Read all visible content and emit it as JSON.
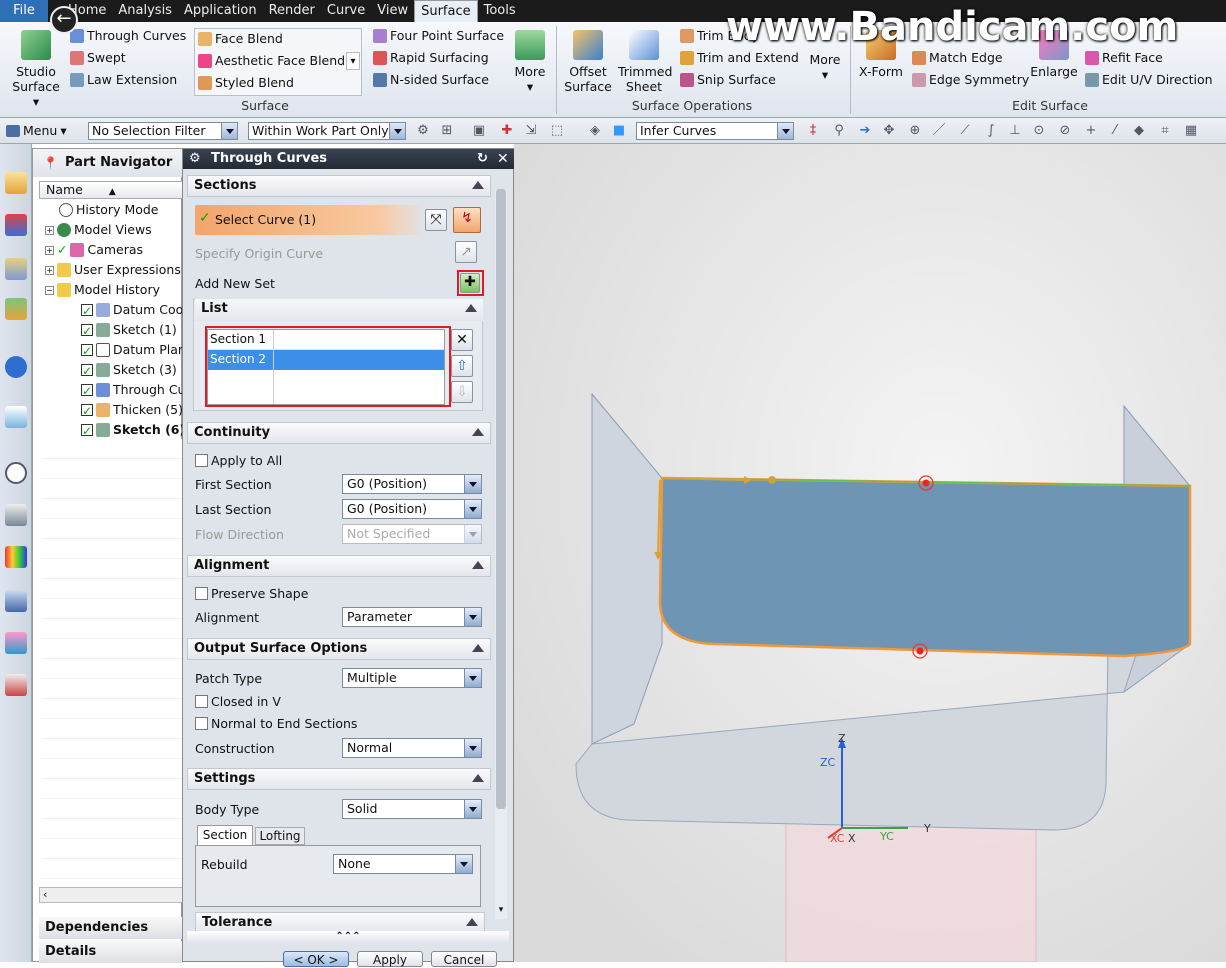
{
  "menubar": {
    "items": [
      "File",
      "Home",
      "Analysis",
      "Application",
      "Render",
      "Curve",
      "View",
      "Surface",
      "Tools"
    ],
    "active": "Surface"
  },
  "watermark": "www.Bandicam.com",
  "ribbon": {
    "studio_surface": "Studio Surface",
    "surface_items": [
      "Through Curves",
      "Swept",
      "Law Extension"
    ],
    "blend_items": [
      "Face Blend",
      "Aesthetic Face Blend",
      "Styled Blend"
    ],
    "four_items": [
      "Four Point Surface",
      "Rapid Surfacing",
      "N-sided Surface"
    ],
    "more1": "More",
    "surface_group": "Surface",
    "offset_surface": "Offset Surface",
    "trimmed_sheet": "Trimmed Sheet",
    "ops_items": [
      "Trim Body",
      "Trim and Extend",
      "Snip Surface"
    ],
    "more2": "More",
    "ops_group": "Surface Operations",
    "xform": "X-Form",
    "edit_items": [
      "Match Edge",
      "Edge Symmetry"
    ],
    "enlarge": "Enlarge",
    "edit_items2": [
      "Refit Face",
      "Edit U/V Direction"
    ],
    "edit_group": "Edit Surface"
  },
  "toolbar": {
    "menu": "Menu",
    "selection_filter": "No Selection Filter",
    "scope": "Within Work Part Only",
    "curve_rule": "Infer Curves"
  },
  "navigator": {
    "title": "Part Navigator",
    "column": "Name",
    "items": [
      "History Mode",
      "Model Views",
      "Cameras",
      "User Expressions",
      "Model History",
      "Datum Coo",
      "Sketch (1) \"",
      "Datum Plan",
      "Sketch (3) \"",
      "Through Cu",
      "Thicken (5)",
      "Sketch (6)"
    ],
    "dependencies": "Dependencies",
    "details": "Details"
  },
  "dialog": {
    "title": "Through Curves",
    "sections_header": "Sections",
    "select_curve": "Select Curve (1)",
    "specify_origin": "Specify Origin Curve",
    "add_new_set": "Add New Set",
    "list_header": "List",
    "list_rows": [
      "Section  1",
      "Section  2"
    ],
    "continuity_header": "Continuity",
    "apply_to_all": "Apply to All",
    "first_section": "First Section",
    "first_section_value": "G0 (Position)",
    "last_section": "Last Section",
    "last_section_value": "G0 (Position)",
    "flow_direction": "Flow Direction",
    "flow_direction_value": "Not Specified",
    "alignment_header": "Alignment",
    "preserve_shape": "Preserve Shape",
    "alignment": "Alignment",
    "alignment_value": "Parameter",
    "output_header": "Output Surface Options",
    "patch_type": "Patch Type",
    "patch_type_value": "Multiple",
    "closed_in_v": "Closed in V",
    "normal_to_end": "Normal to End Sections",
    "construction": "Construction",
    "construction_value": "Normal",
    "settings_header": "Settings",
    "body_type": "Body Type",
    "body_type_value": "Solid",
    "tab_section": "Section",
    "tab_lofting": "Lofting",
    "rebuild": "Rebuild",
    "rebuild_value": "None",
    "tolerance_header": "Tolerance",
    "ok": "< OK >",
    "apply": "Apply",
    "cancel": "Cancel"
  },
  "axes": {
    "z": "Z",
    "zc": "ZC",
    "yc": "YC",
    "y": "Y",
    "xc": "XC",
    "x": "X"
  },
  "colors": {
    "accent": "#2e6fb7",
    "highlight": "#e01b24",
    "surface": "#6a92b0",
    "edge": "#f0973a"
  }
}
